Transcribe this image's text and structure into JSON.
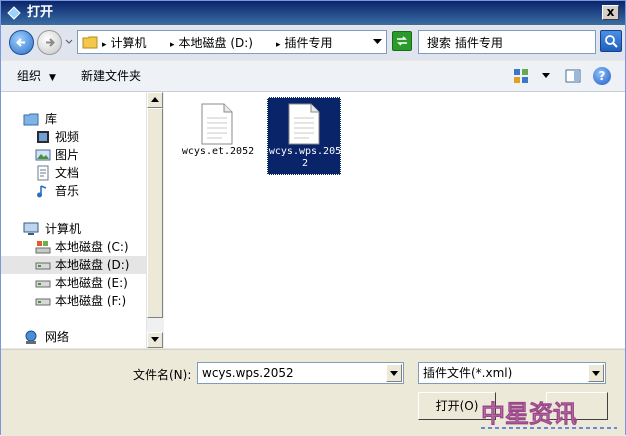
{
  "window": {
    "title": "打开",
    "close_label": "x"
  },
  "address": {
    "crumbs": [
      "计算机",
      "本地磁盘 (D:)",
      "插件专用"
    ]
  },
  "search": {
    "value": "搜索 插件专用"
  },
  "toolbar": {
    "organize": "组织",
    "new_folder": "新建文件夹"
  },
  "help_label": "?",
  "nav": {
    "libraries": "库",
    "library_items": [
      "视频",
      "图片",
      "文档",
      "音乐"
    ],
    "computer": "计算机",
    "drives": [
      "本地磁盘 (C:)",
      "本地磁盘 (D:)",
      "本地磁盘 (E:)",
      "本地磁盘 (F:)"
    ],
    "network": "网络",
    "selected": "本地磁盘 (D:)"
  },
  "files": [
    {
      "name": "wcys.et.2052",
      "selected": false
    },
    {
      "name": "wcys.wps.2052",
      "selected": true
    }
  ],
  "bottom": {
    "filename_label": "文件名(N):",
    "filename_value": "wcys.wps.2052",
    "filter_value": "插件文件(*.xml)",
    "open_label": "打开(O)"
  },
  "watermark": {
    "text": "中星资讯"
  },
  "colors": {
    "selection": "#0a246a",
    "titlebar": "#0a246a"
  }
}
